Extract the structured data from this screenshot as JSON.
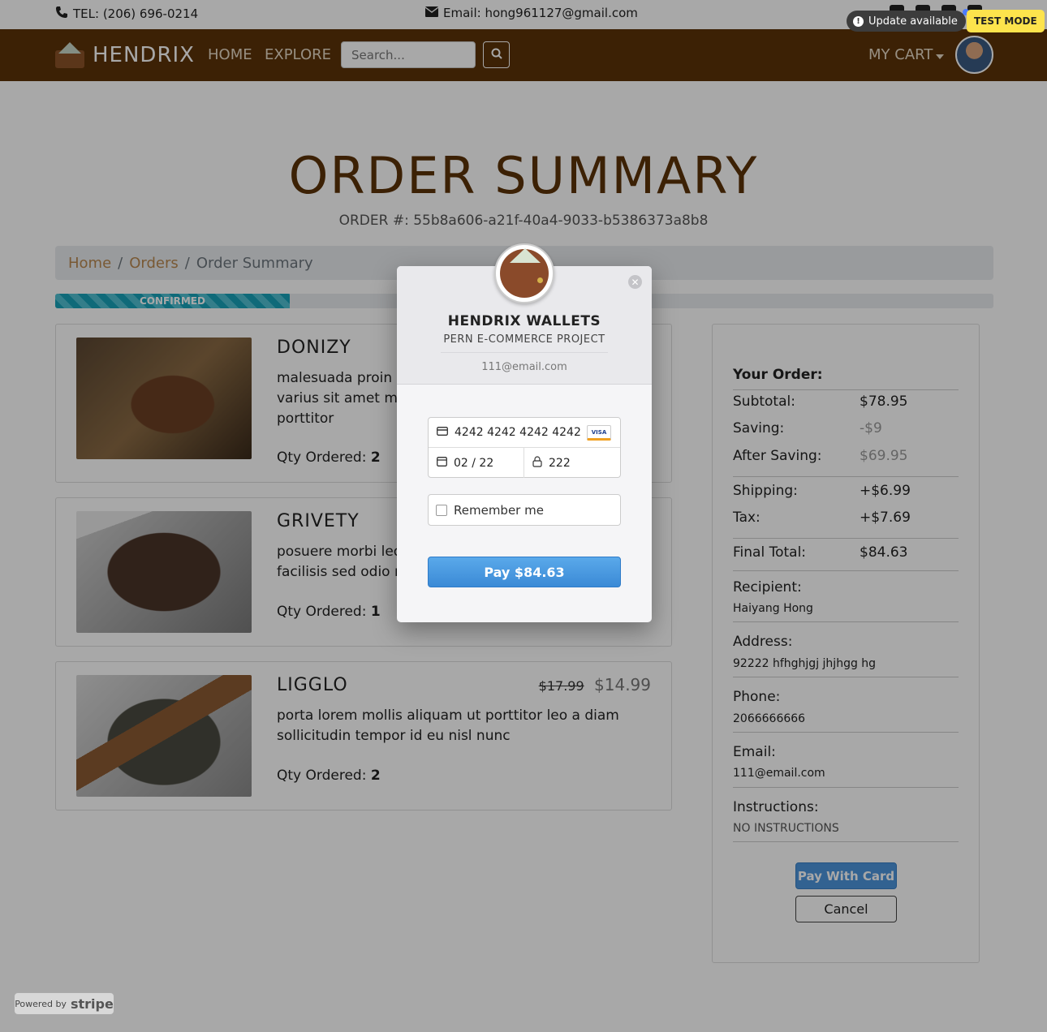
{
  "topbar": {
    "tel": "TEL: (206) 696-0214",
    "email": "Email: hong961127@gmail.com",
    "update": "Update available",
    "test_mode": "TEST MODE"
  },
  "navbar": {
    "brand": "HENDRIX",
    "home": "HOME",
    "explore": "EXPLORE",
    "search_placeholder": "Search...",
    "cart": "MY CART"
  },
  "page": {
    "title": "ORDER SUMMARY",
    "order_number": "ORDER #: 55b8a606-a21f-40a4-9033-b5386373a8b8",
    "breadcrumb": [
      "Home",
      "Orders",
      "Order Summary"
    ],
    "status": "CONFIRMED",
    "status_progress": 0.25
  },
  "items": [
    {
      "name": "DONIZY",
      "desc": "malesuada proin libero nunc consequat interdum varius sit amet mattis vulputate enim nulla aliquet porttitor",
      "qty_label": "Qty Ordered:",
      "qty": "2"
    },
    {
      "name": "GRIVETY",
      "desc": "posuere morbi leo urna molestie at elementum eu facilisis sed odio morbi",
      "qty_label": "Qty Ordered:",
      "qty": "1"
    },
    {
      "name": "LIGGLO",
      "old_price": "$17.99",
      "price": "$14.99",
      "desc": "porta lorem mollis aliquam ut porttitor leo a diam sollicitudin tempor id eu nisl nunc",
      "qty_label": "Qty Ordered:",
      "qty": "2"
    }
  ],
  "summary": {
    "heading": "Your Order:",
    "subtotal_k": "Subtotal:",
    "subtotal_v": "$78.95",
    "saving_k": "Saving:",
    "saving_v": "-$9",
    "after_k": "After Saving:",
    "after_v": "$69.95",
    "shipping_k": "Shipping:",
    "shipping_v": "+$6.99",
    "tax_k": "Tax:",
    "tax_v": "+$7.69",
    "final_k": "Final Total:",
    "final_v": "$84.63",
    "recipient_k": "Recipient:",
    "recipient_v": "Haiyang Hong",
    "address_k": "Address:",
    "address_v": "92222 hfhghjgj jhjhgg hg",
    "phone_k": "Phone:",
    "phone_v": "2066666666",
    "email_k": "Email:",
    "email_v": "111@email.com",
    "instructions_k": "Instructions:",
    "instructions_v": "NO INSTRUCTIONS",
    "pay_button": "Pay With Card",
    "cancel_button": "Cancel"
  },
  "modal": {
    "title": "HENDRIX WALLETS",
    "subtitle": "PERN E-COMMERCE PROJECT",
    "email": "111@email.com",
    "card_number": "4242 4242 4242 4242",
    "card_brand": "VISA",
    "expiry": "02 / 22",
    "cvc": "222",
    "remember": "Remember me",
    "pay": "Pay $84.63"
  },
  "footer": {
    "powered_by": "Powered by",
    "stripe": "stripe"
  },
  "colors": {
    "brand_brown": "#5c3309",
    "accent_tan": "#b8884f",
    "stripe_blue": "#3b8ad6",
    "progress_teal": "#17a2b8"
  }
}
